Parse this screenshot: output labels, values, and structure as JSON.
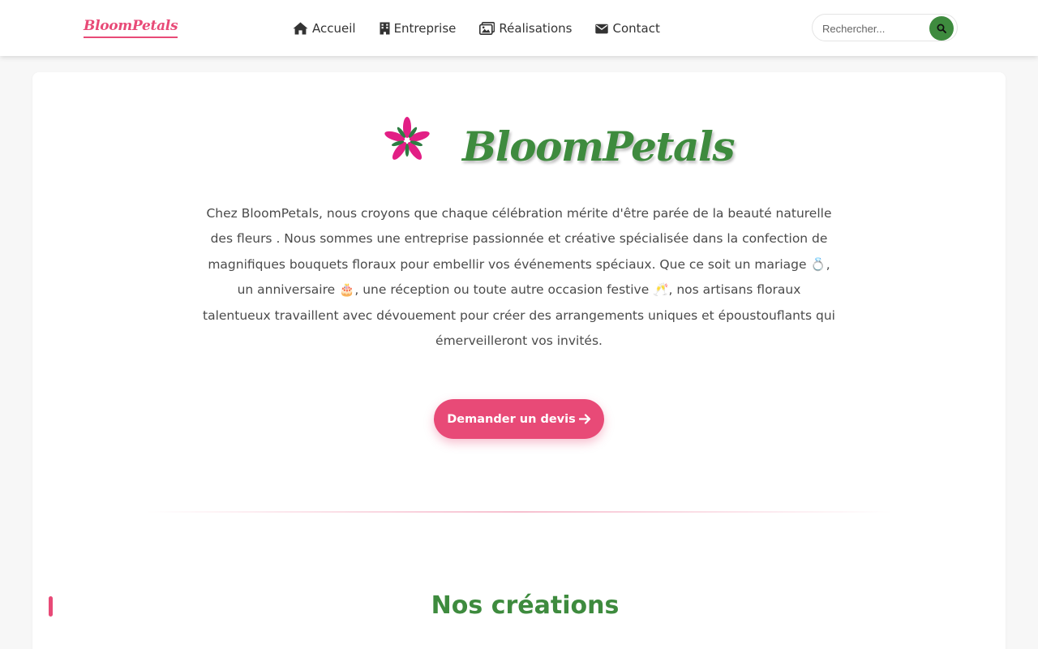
{
  "navbar": {
    "brand": "BloomPetals",
    "links": [
      {
        "label": "Accueil",
        "icon": "home-icon"
      },
      {
        "label": "Entreprise",
        "icon": "building-icon"
      },
      {
        "label": "Réalisations",
        "icon": "images-icon"
      },
      {
        "label": "Contact",
        "icon": "envelope-icon"
      }
    ],
    "search": {
      "placeholder": "Rechercher...",
      "icon": "search-icon"
    }
  },
  "hero": {
    "logo_text": "BloomPetals",
    "logo_icon": "flower-icon",
    "intro": "Chez BloomPetals, nous croyons que chaque célébration mérite d'être parée de la beauté naturelle des fleurs . Nous sommes une entreprise passionnée et créative spécialisée dans la confection de magnifiques bouquets floraux pour embellir vos événements spéciaux. Que ce soit un mariage 💍, un anniversaire 🎂, une réception ou toute autre occasion festive 🥂, nos artisans floraux talentueux travaillent avec dévouement pour créer des arrangements uniques et époustouflants qui émerveilleront vos invités.",
    "cta_label": "Demander un devis",
    "cta_icon": "arrow-right-icon"
  },
  "creations": {
    "title": "Nos créations"
  },
  "colors": {
    "pink": "#e84a77",
    "green": "#3e8b3e",
    "background": "#f7f7f7"
  }
}
